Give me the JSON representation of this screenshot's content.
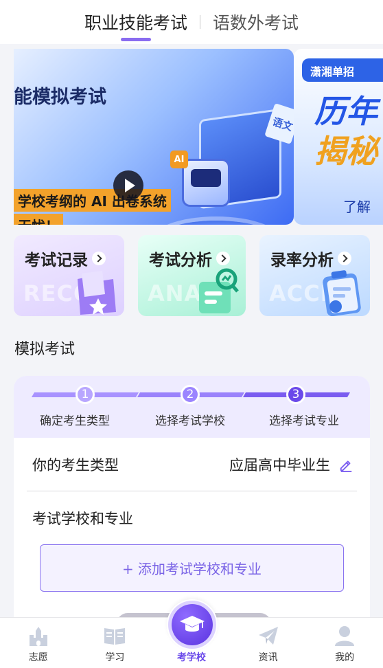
{
  "top_tabs": [
    {
      "label": "职业技能考试",
      "active": true
    },
    {
      "label": "语数外考试",
      "active": false
    }
  ],
  "banner": {
    "title": "能模拟考试",
    "strip1": "学校考纲的 AI 出卷系统",
    "strip2": "无忧！",
    "ai_badge": "AI",
    "paper_label": "语文",
    "next": {
      "badge": "潇湘单招",
      "big1": "历年",
      "big2": "揭秘",
      "more": "了解"
    }
  },
  "cards": [
    {
      "title": "考试记录",
      "ghost": "RECO",
      "icon": "folder-star-icon"
    },
    {
      "title": "考试分析",
      "ghost": "ANAL",
      "icon": "magnifier-chart-icon"
    },
    {
      "title": "录率分析",
      "ghost": "ACCE",
      "icon": "clipboard-chart-icon"
    }
  ],
  "section_title": "模拟考试",
  "steps": [
    {
      "num": "1",
      "label": "确定考生类型"
    },
    {
      "num": "2",
      "label": "选择考试学校"
    },
    {
      "num": "3",
      "label": "选择考试专业"
    }
  ],
  "form": {
    "type_label": "你的考生类型",
    "type_value": "应届高中毕业生",
    "school_label": "考试学校和专业",
    "add_button": "+ 添加考试学校和专业"
  },
  "bottom_nav": [
    {
      "label": "志愿",
      "icon": "castle-icon",
      "active": false
    },
    {
      "label": "学习",
      "icon": "book-icon",
      "active": false
    },
    {
      "label": "考学校",
      "icon": "graduation-cap-icon",
      "active": true
    },
    {
      "label": "资讯",
      "icon": "paper-plane-icon",
      "active": false
    },
    {
      "label": "我的",
      "icon": "user-icon",
      "active": false
    }
  ],
  "colors": {
    "accent": "#6a49ea",
    "accent_light": "#eeebff",
    "icon_gray": "#c9d0de"
  }
}
